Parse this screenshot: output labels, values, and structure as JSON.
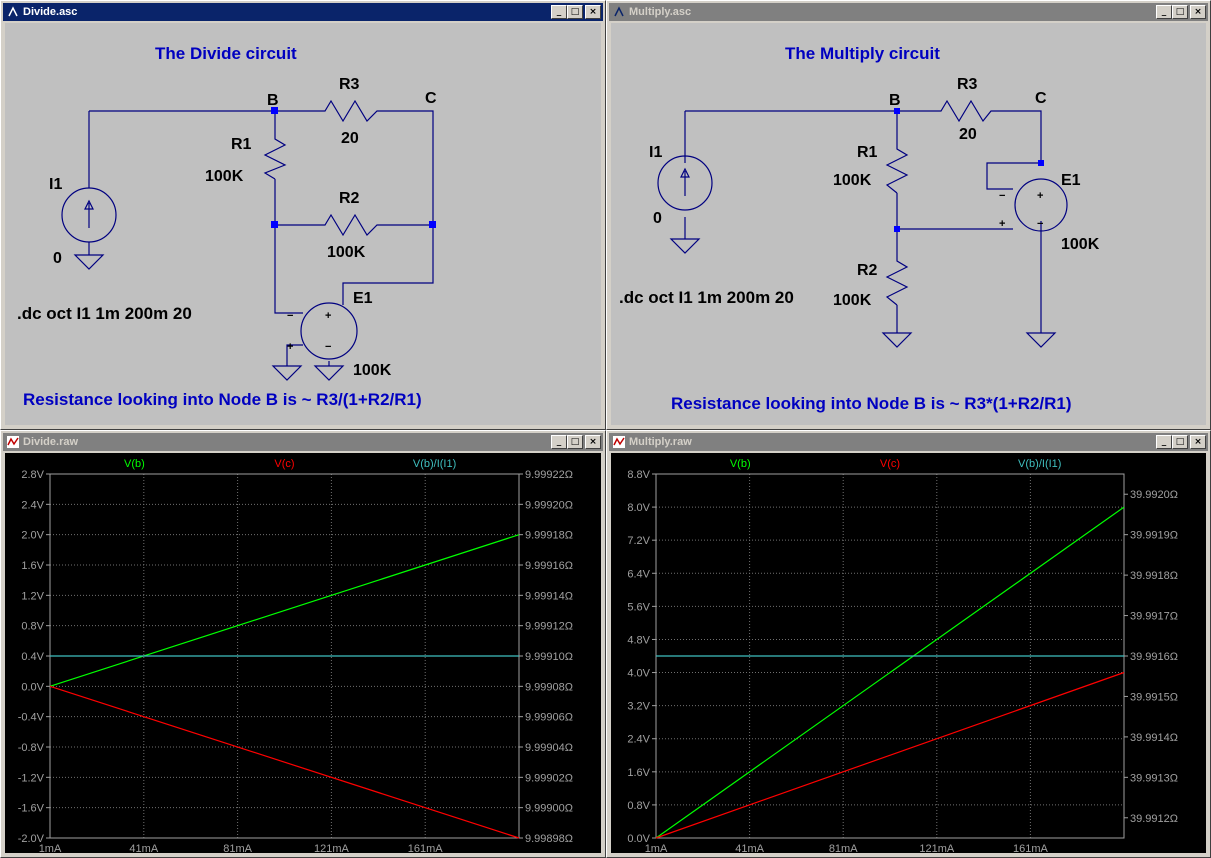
{
  "windows": {
    "divide_asc": {
      "title": "Divide.asc",
      "heading": "The Divide circuit",
      "labels": {
        "nodeB": "B",
        "nodeC": "C",
        "R3": "R3",
        "R3val": "20",
        "R1": "R1",
        "R1val": "100K",
        "R2": "R2",
        "R2val": "100K",
        "I1": "I1",
        "I1val": "0",
        "E1": "E1",
        "E1val": "100K"
      },
      "directive": ".dc oct I1 1m 200m 20",
      "note": "Resistance looking into Node B is ~ R3/(1+R2/R1)"
    },
    "multiply_asc": {
      "title": "Multiply.asc",
      "heading": "The Multiply circuit",
      "labels": {
        "nodeB": "B",
        "nodeC": "C",
        "R3": "R3",
        "R3val": "20",
        "R1": "R1",
        "R1val": "100K",
        "R2": "R2",
        "R2val": "100K",
        "I1": "I1",
        "I1val": "0",
        "E1": "E1",
        "E1val": "100K"
      },
      "directive": ".dc oct I1 1m 200m 20",
      "note": "Resistance looking into Node B is ~ R3*(1+R2/R1)"
    },
    "divide_raw": {
      "title": "Divide.raw"
    },
    "multiply_raw": {
      "title": "Multiply.raw"
    }
  },
  "colors": {
    "vb": "#00ff00",
    "vc": "#ff0000",
    "ratio": "#3fbfbf",
    "grid": "#707070",
    "label_blue": "#0000c0",
    "wire": "#000080",
    "tick": "#a0a0a0"
  },
  "chart_data": [
    {
      "type": "line",
      "window": "Divide.raw",
      "legend": [
        "V(b)",
        "V(c)",
        "V(b)/I(I1)"
      ],
      "x_ticks": [
        "1mA",
        "41mA",
        "81mA",
        "121mA",
        "161mA"
      ],
      "xlim": [
        1,
        201
      ],
      "left_axis": {
        "ticks": [
          "2.8V",
          "2.4V",
          "2.0V",
          "1.6V",
          "1.2V",
          "0.8V",
          "0.4V",
          "0.0V",
          "-0.4V",
          "-0.8V",
          "-1.2V",
          "-1.6V",
          "-2.0V"
        ],
        "ylim": [
          -2.0,
          2.8
        ]
      },
      "right_axis": {
        "ticks": [
          "9.99922Ω",
          "9.99920Ω",
          "9.99918Ω",
          "9.99916Ω",
          "9.99914Ω",
          "9.99912Ω",
          "9.99910Ω",
          "9.99908Ω",
          "9.99906Ω",
          "9.99904Ω",
          "9.99902Ω",
          "9.99900Ω",
          "9.99898Ω"
        ],
        "ylim": [
          9.99898,
          9.99922
        ]
      },
      "series": [
        {
          "name": "V(b)",
          "axis": "left",
          "x": [
            1,
            201
          ],
          "y": [
            0.0,
            2.0
          ]
        },
        {
          "name": "V(c)",
          "axis": "left",
          "x": [
            1,
            201
          ],
          "y": [
            0.0,
            -2.0
          ]
        },
        {
          "name": "V(b)/I(I1)",
          "axis": "right",
          "x": [
            1,
            201
          ],
          "y": [
            9.9991,
            9.9991
          ]
        }
      ]
    },
    {
      "type": "line",
      "window": "Multiply.raw",
      "legend": [
        "V(b)",
        "V(c)",
        "V(b)/I(I1)"
      ],
      "x_ticks": [
        "1mA",
        "41mA",
        "81mA",
        "121mA",
        "161mA"
      ],
      "xlim": [
        1,
        201
      ],
      "left_axis": {
        "ticks": [
          "8.8V",
          "8.0V",
          "7.2V",
          "6.4V",
          "5.6V",
          "4.8V",
          "4.0V",
          "3.2V",
          "2.4V",
          "1.6V",
          "0.8V",
          "0.0V"
        ],
        "ylim": [
          0.0,
          8.8
        ]
      },
      "right_axis": {
        "ticks": [
          "39.9920Ω",
          "39.9919Ω",
          "39.9918Ω",
          "39.9917Ω",
          "39.9916Ω",
          "39.9915Ω",
          "39.9914Ω",
          "39.9913Ω",
          "39.9912Ω"
        ],
        "ylim": [
          39.99115,
          39.99205
        ]
      },
      "series": [
        {
          "name": "V(b)",
          "axis": "left",
          "x": [
            1,
            201
          ],
          "y": [
            0.0,
            8.0
          ]
        },
        {
          "name": "V(c)",
          "axis": "left",
          "x": [
            1,
            201
          ],
          "y": [
            0.0,
            4.0
          ]
        },
        {
          "name": "V(b)/I(I1)",
          "axis": "right",
          "x": [
            1,
            201
          ],
          "y": [
            39.9916,
            39.9916
          ]
        }
      ]
    }
  ]
}
